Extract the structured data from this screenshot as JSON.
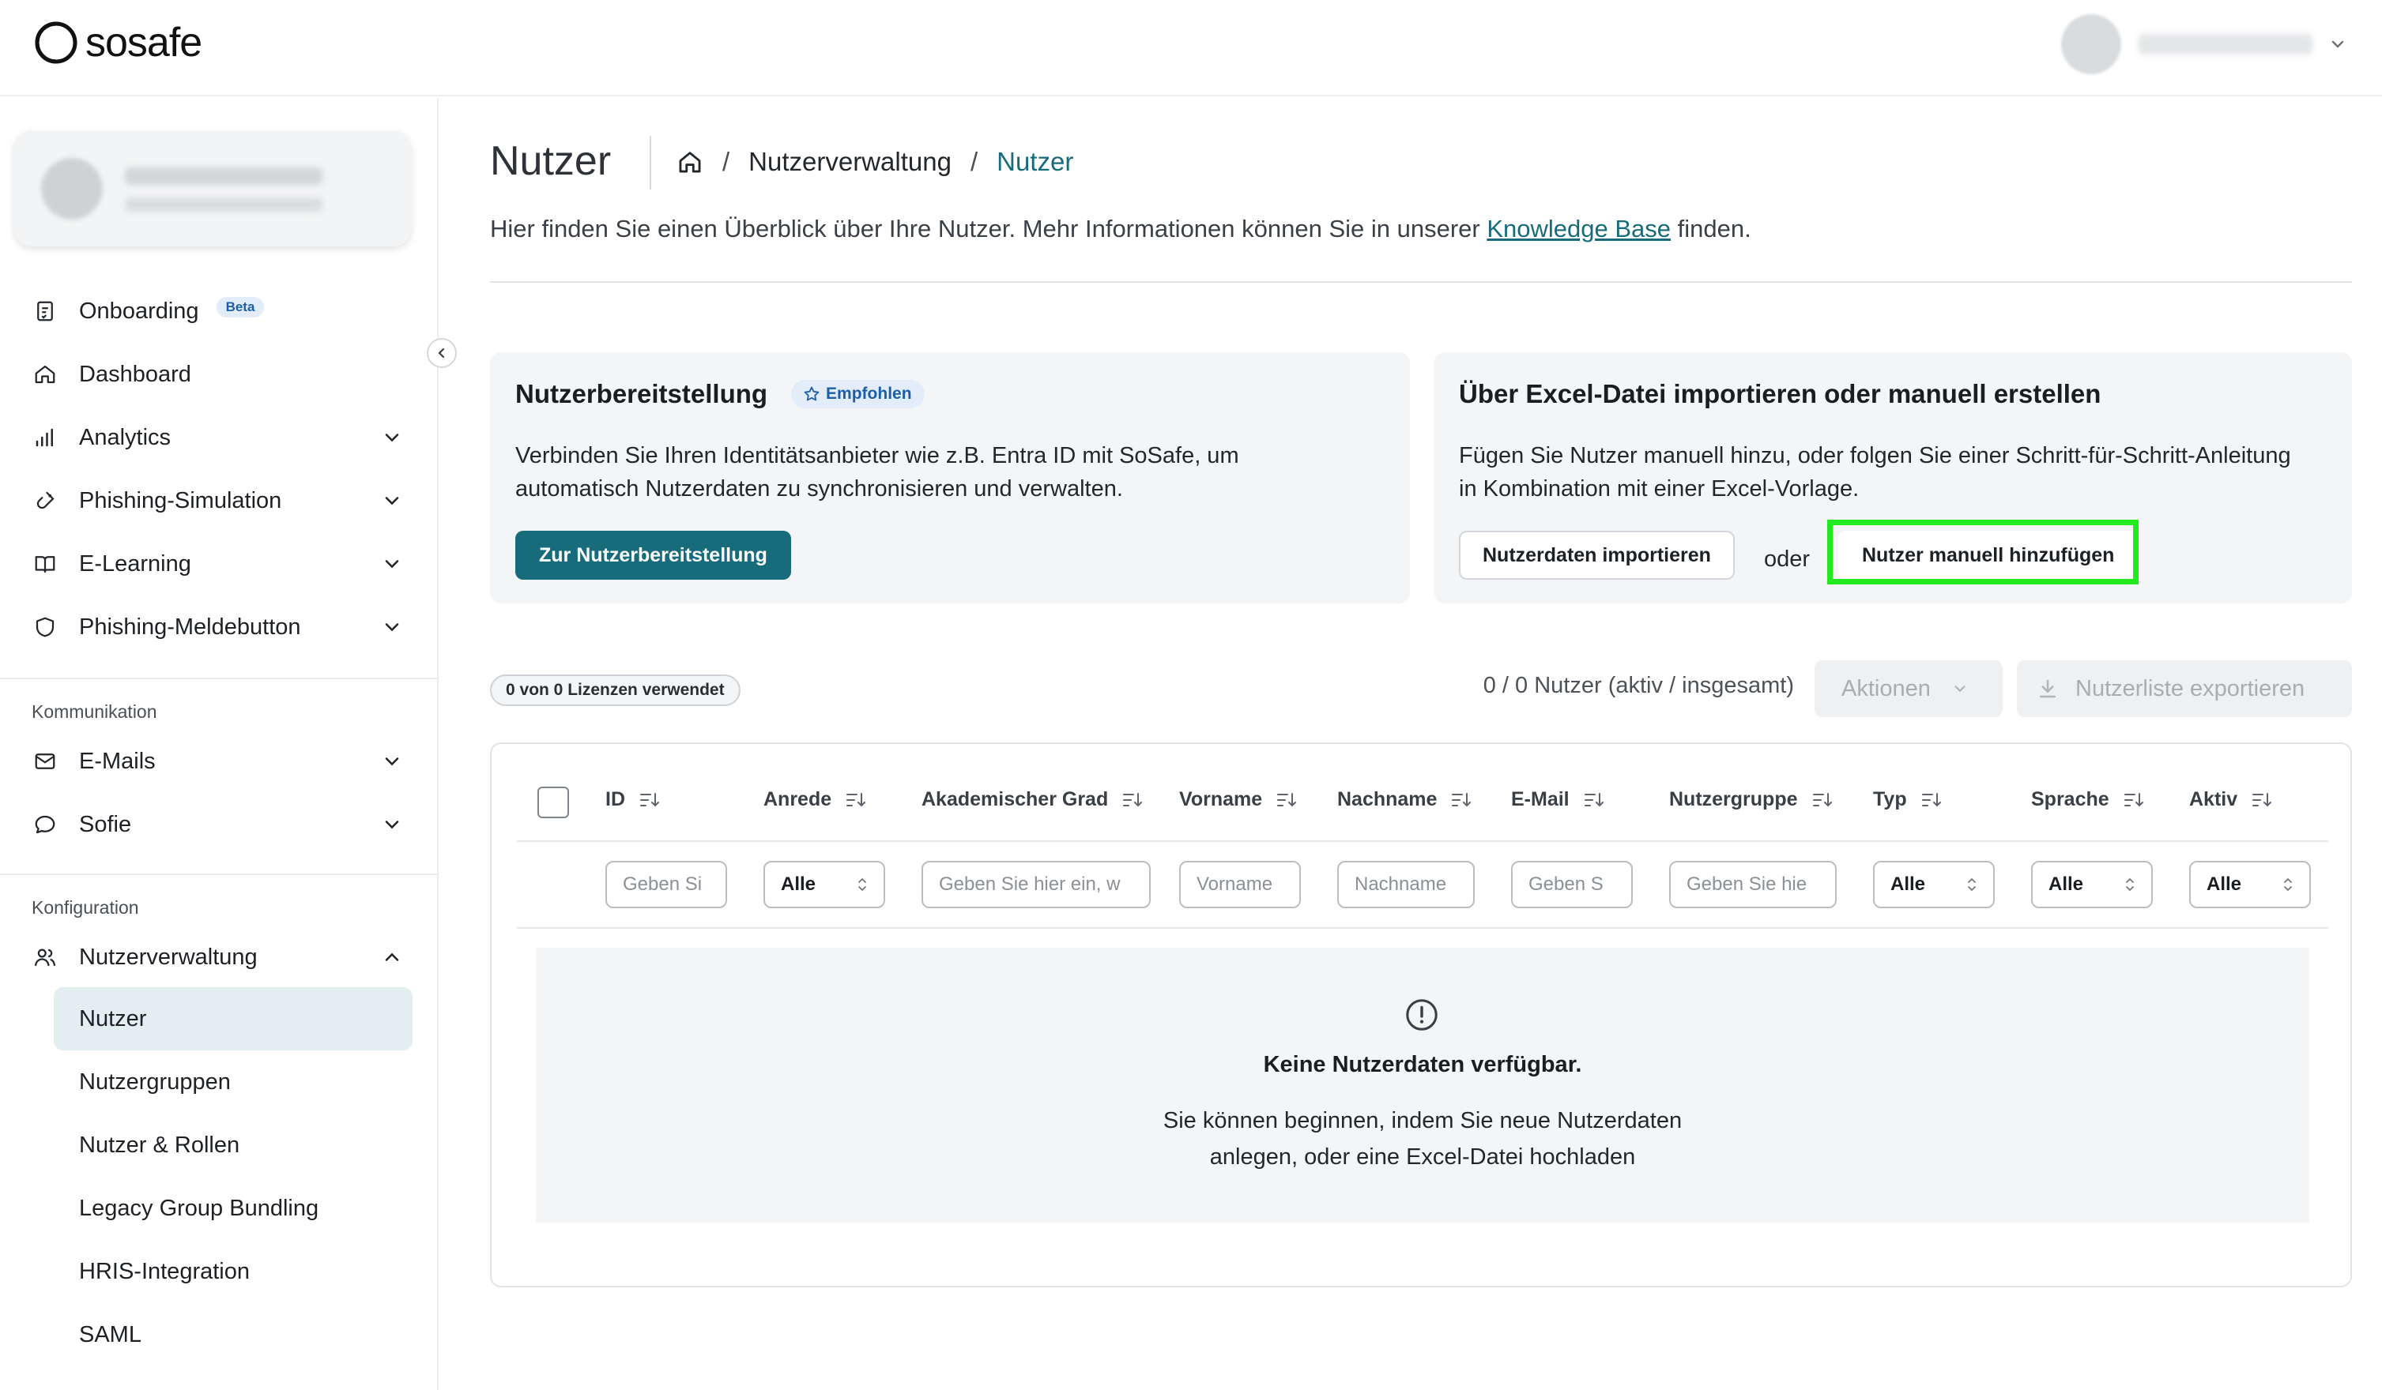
{
  "app": {
    "logo_text": "sosafe"
  },
  "sidebar": {
    "nav": [
      {
        "label": "Onboarding",
        "badge": "Beta",
        "icon": "checklist-icon"
      },
      {
        "label": "Dashboard",
        "icon": "home-icon"
      },
      {
        "label": "Analytics",
        "icon": "bar-chart-icon"
      },
      {
        "label": "Phishing-Simulation",
        "icon": "hook-icon"
      },
      {
        "label": "E-Learning",
        "icon": "book-icon"
      },
      {
        "label": "Phishing-Meldebutton",
        "icon": "shield-icon"
      }
    ],
    "kommunikation_label": "Kommunikation",
    "kommunikation": [
      {
        "label": "E-Mails",
        "icon": "mail-icon"
      },
      {
        "label": "Sofie",
        "icon": "chat-bubble-icon"
      }
    ],
    "konfiguration_label": "Konfiguration",
    "nutzerverwaltung": {
      "label": "Nutzerverwaltung",
      "icon": "users-icon"
    },
    "sub_items": [
      {
        "label": "Nutzer",
        "active": true
      },
      {
        "label": "Nutzergruppen"
      },
      {
        "label": "Nutzer & Rollen"
      },
      {
        "label": "Legacy Group Bundling"
      },
      {
        "label": "HRIS-Integration"
      },
      {
        "label": "SAML"
      }
    ]
  },
  "header": {
    "title": "Nutzer",
    "breadcrumb": {
      "level1": "Nutzerverwaltung",
      "current": "Nutzer"
    },
    "intro_before": "Hier finden Sie einen Überblick über Ihre Nutzer. Mehr Informationen können Sie in unserer ",
    "intro_link": "Knowledge Base",
    "intro_after": " finden."
  },
  "card_provisioning": {
    "title": "Nutzerbereitstellung",
    "badge": "Empfohlen",
    "text_line1": "Verbinden Sie Ihren Identitätsanbieter wie z.B. Entra ID mit SoSafe, um",
    "text_line2": "automatisch Nutzerdaten zu synchronisieren und verwalten.",
    "button": "Zur Nutzerbereitstellung"
  },
  "card_import": {
    "title": "Über Excel-Datei importieren oder manuell erstellen",
    "text_line1": "Fügen Sie Nutzer manuell hinzu, oder folgen Sie einer Schritt-für-Schritt-Anleitung",
    "text_line2": "in Kombination mit einer Excel-Vorlage.",
    "import_button": "Nutzerdaten importieren",
    "or": "oder",
    "manual_button": "Nutzer manuell hinzufügen"
  },
  "toolbar": {
    "license_badge": "0 von 0 Lizenzen verwendet",
    "count": "0 / 0 Nutzer (aktiv / insgesamt)",
    "actions": "Aktionen",
    "export": "Nutzerliste exportieren"
  },
  "table": {
    "columns": [
      "ID",
      "Anrede",
      "Akademischer Grad",
      "Vorname",
      "Nachname",
      "E-Mail",
      "Nutzergruppe",
      "Typ",
      "Sprache",
      "Aktiv"
    ],
    "filters": {
      "id": "Geben Si",
      "anrede": "Alle",
      "grad": "Geben Sie hier ein, w",
      "vorname": "Vorname",
      "nachname": "Nachname",
      "email": "Geben S",
      "gruppe": "Geben Sie hie",
      "typ": "Alle",
      "sprache": "Alle",
      "aktiv": "Alle"
    },
    "empty_title": "Keine Nutzerdaten verfügbar.",
    "empty_line1": "Sie können beginnen, indem Sie neue Nutzerdaten",
    "empty_line2": "anlegen, oder eine Excel-Datei hochladen"
  },
  "colors": {
    "primary": "#186b7a",
    "highlight": "#22ea1f",
    "badge_blue": "#1c5fa8"
  }
}
